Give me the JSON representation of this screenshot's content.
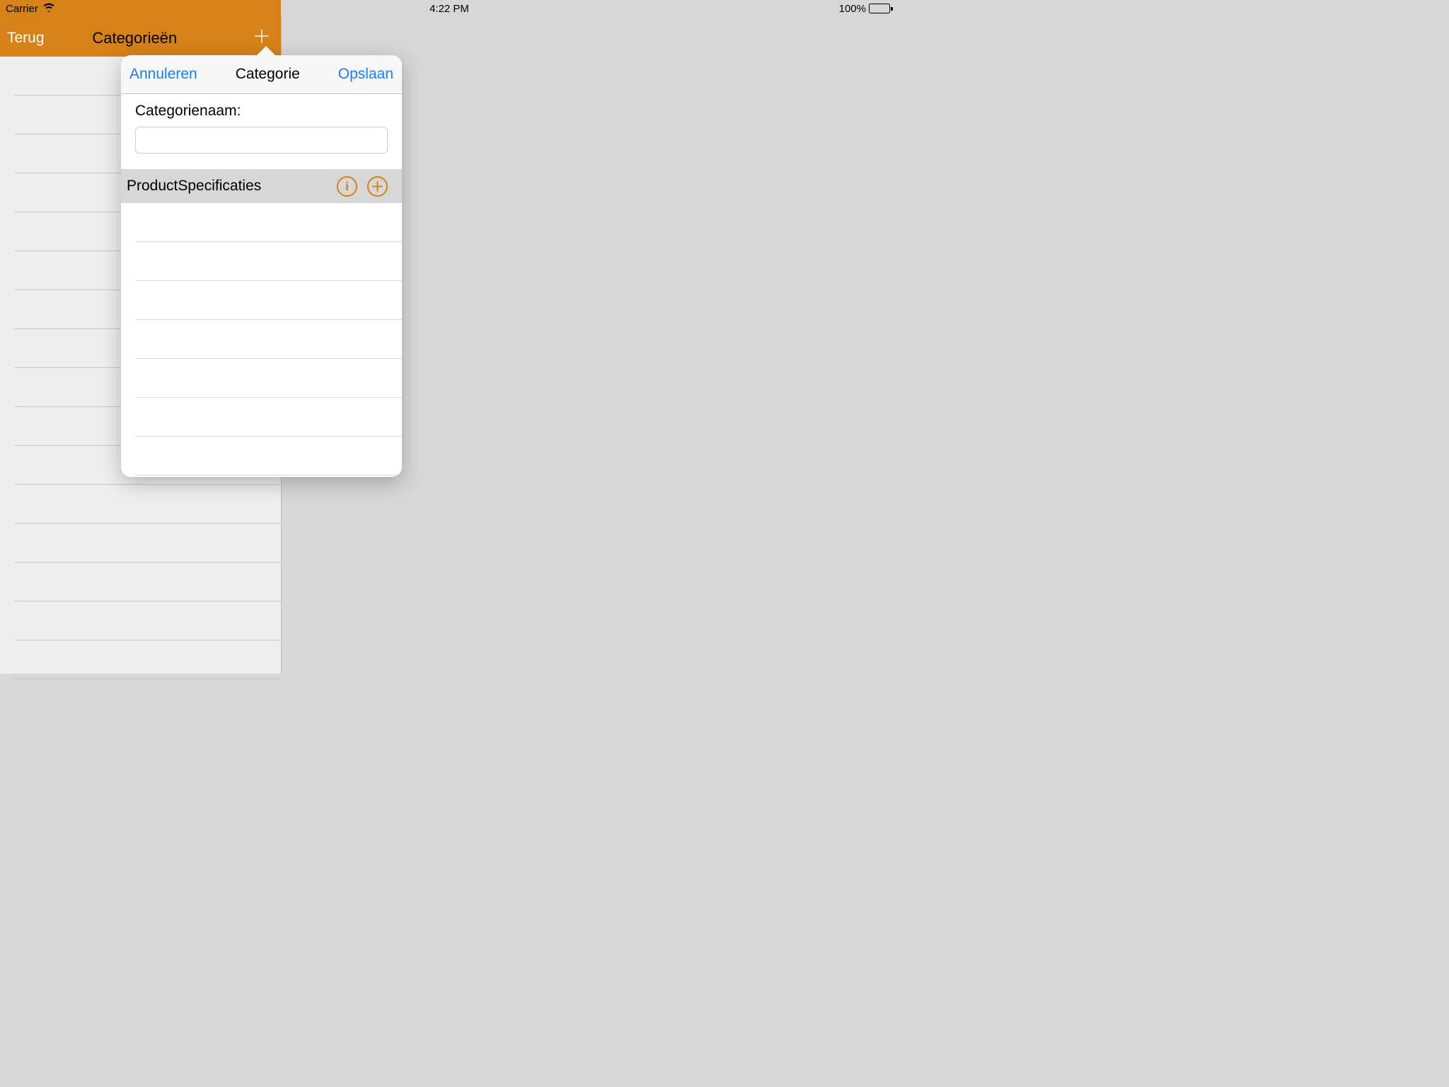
{
  "status_bar": {
    "carrier": "Carrier",
    "time": "4:22 PM",
    "battery_pct": "100%"
  },
  "sidebar": {
    "back_label": "Terug",
    "title": "Categorieën",
    "rows": [
      "",
      "",
      "",
      "",
      "",
      "",
      "",
      "",
      "",
      "",
      "",
      "",
      "",
      "",
      "",
      ""
    ]
  },
  "popover": {
    "cancel_label": "Annuleren",
    "title": "Categorie",
    "save_label": "Opslaan",
    "field_label": "Categorienaam:",
    "field_value": "",
    "section_title": "ProductSpecificaties",
    "spec_rows": [
      "",
      "",
      "",
      "",
      "",
      "",
      ""
    ]
  }
}
